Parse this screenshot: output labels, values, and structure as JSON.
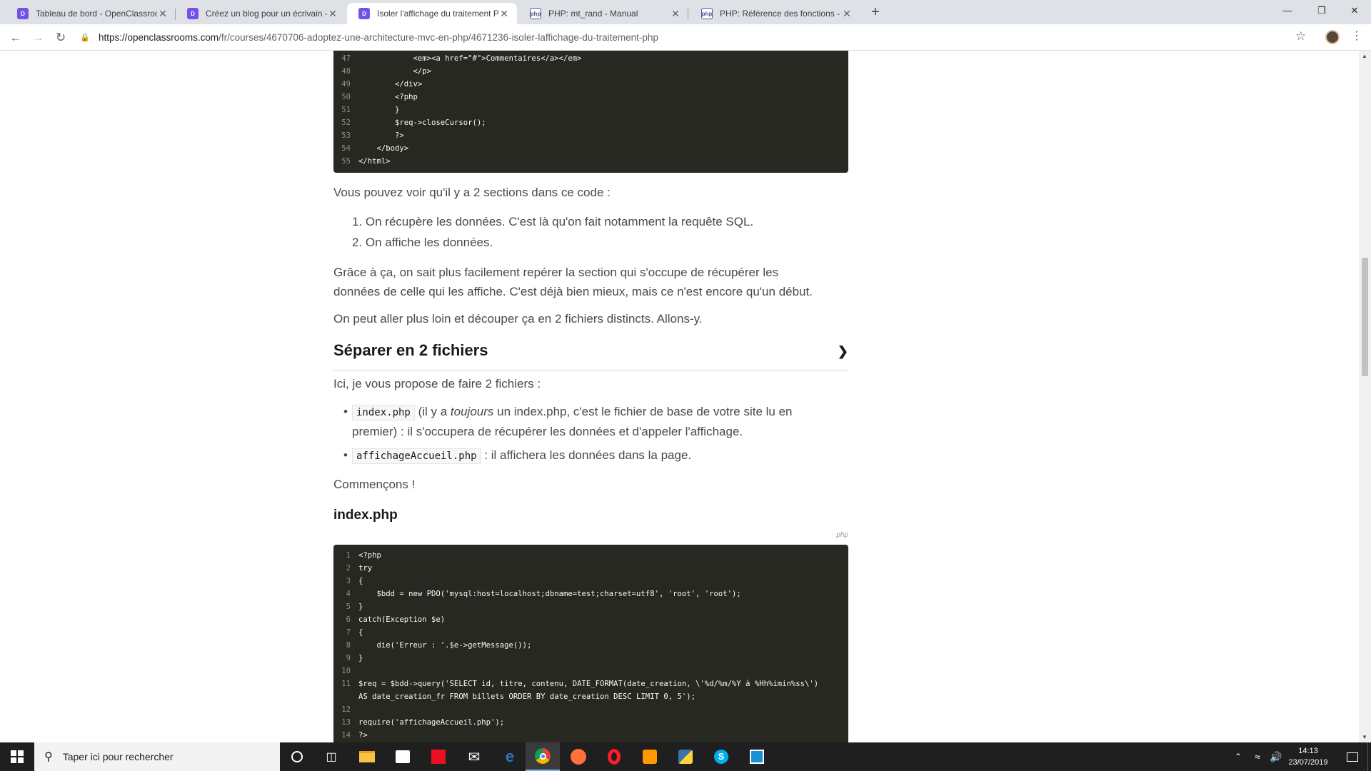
{
  "browser": {
    "tabs": [
      {
        "title": "Tableau de bord - OpenClassrooms",
        "favicon": "openclassrooms-icon",
        "active": false
      },
      {
        "title": "Créez un blog pour un écrivain - ",
        "favicon": "openclassrooms-icon",
        "active": false
      },
      {
        "title": "Isoler l'affichage du traitement PHP",
        "favicon": "openclassrooms-icon",
        "active": true
      },
      {
        "title": "PHP: mt_rand - Manual",
        "favicon": "php-icon",
        "active": false
      },
      {
        "title": "PHP: Référence des fonctions - M",
        "favicon": "php-icon",
        "active": false
      }
    ],
    "url_host": "https://openclassrooms.com",
    "url_path": "/fr/courses/4670706-adoptez-une-architecture-mvc-en-php/4671236-isoler-laffichage-du-traitement-php"
  },
  "content": {
    "code_top": [
      {
        "n": "47",
        "text": "            <em><a href=\"#\">Commentaires</a></em>"
      },
      {
        "n": "48",
        "text": "            </p>"
      },
      {
        "n": "49",
        "text": "        </div>"
      },
      {
        "n": "50",
        "text": "        <?php"
      },
      {
        "n": "51",
        "text": "        }"
      },
      {
        "n": "52",
        "text": "        $req->closeCursor();"
      },
      {
        "n": "53",
        "text": "        ?>"
      },
      {
        "n": "54",
        "text": "    </body>"
      },
      {
        "n": "55",
        "text": "</html>"
      }
    ],
    "para1": "Vous pouvez voir qu'il y a 2 sections dans ce code :",
    "list1": [
      "On récupère les données. C'est là qu'on fait notamment la requête SQL.",
      "On affiche les données."
    ],
    "para2_line1": "Grâce à ça, on sait plus facilement repérer la section qui s'occupe de récupérer les",
    "para2_line2": "données de celle qui les affiche. C'est déjà bien mieux, mais ce n'est encore qu'un début.",
    "para3": "On peut aller plus loin et découper ça en 2 fichiers distincts. Allons-y.",
    "section_title": "Séparer en 2 fichiers",
    "para4": "Ici, je vous propose de faire 2 fichiers :",
    "bullet1_code": "index.php",
    "bullet1_pre": " (il y a ",
    "bullet1_em": "toujours",
    "bullet1_post": " un index.php, c'est le fichier de base de votre site lu en",
    "bullet1_line2": "premier) : il s'occupera de récupérer les données et d'appeler l'affichage.",
    "bullet2_code": "affichageAccueil.php",
    "bullet2_text": " : il affichera les données dans la page.",
    "para5": "Commençons !",
    "subtitle": "index.php",
    "code_lang": "php",
    "code_bottom": [
      {
        "n": "1",
        "text": "<?php"
      },
      {
        "n": "2",
        "text": "try"
      },
      {
        "n": "3",
        "text": "{"
      },
      {
        "n": "4",
        "text": "    $bdd = new PDO('mysql:host=localhost;dbname=test;charset=utf8', 'root', 'root');"
      },
      {
        "n": "5",
        "text": "}"
      },
      {
        "n": "6",
        "text": "catch(Exception $e)"
      },
      {
        "n": "7",
        "text": "{"
      },
      {
        "n": "8",
        "text": "    die('Erreur : '.$e->getMessage());"
      },
      {
        "n": "9",
        "text": "}"
      },
      {
        "n": "10",
        "text": ""
      },
      {
        "n": "11",
        "text": "$req = $bdd->query('SELECT id, titre, contenu, DATE_FORMAT(date_creation, \\'%d/%m/%Y à %Hh%imin%ss\\')"
      },
      {
        "n": "",
        "text": "AS date_creation_fr FROM billets ORDER BY date_creation DESC LIMIT 0, 5');"
      },
      {
        "n": "12",
        "text": ""
      },
      {
        "n": "13",
        "text": "require('affichageAccueil.php');"
      },
      {
        "n": "14",
        "text": "?>"
      }
    ]
  },
  "taskbar": {
    "search_placeholder": "Taper ici pour rechercher",
    "time": "14:13",
    "date": "23/07/2019"
  }
}
